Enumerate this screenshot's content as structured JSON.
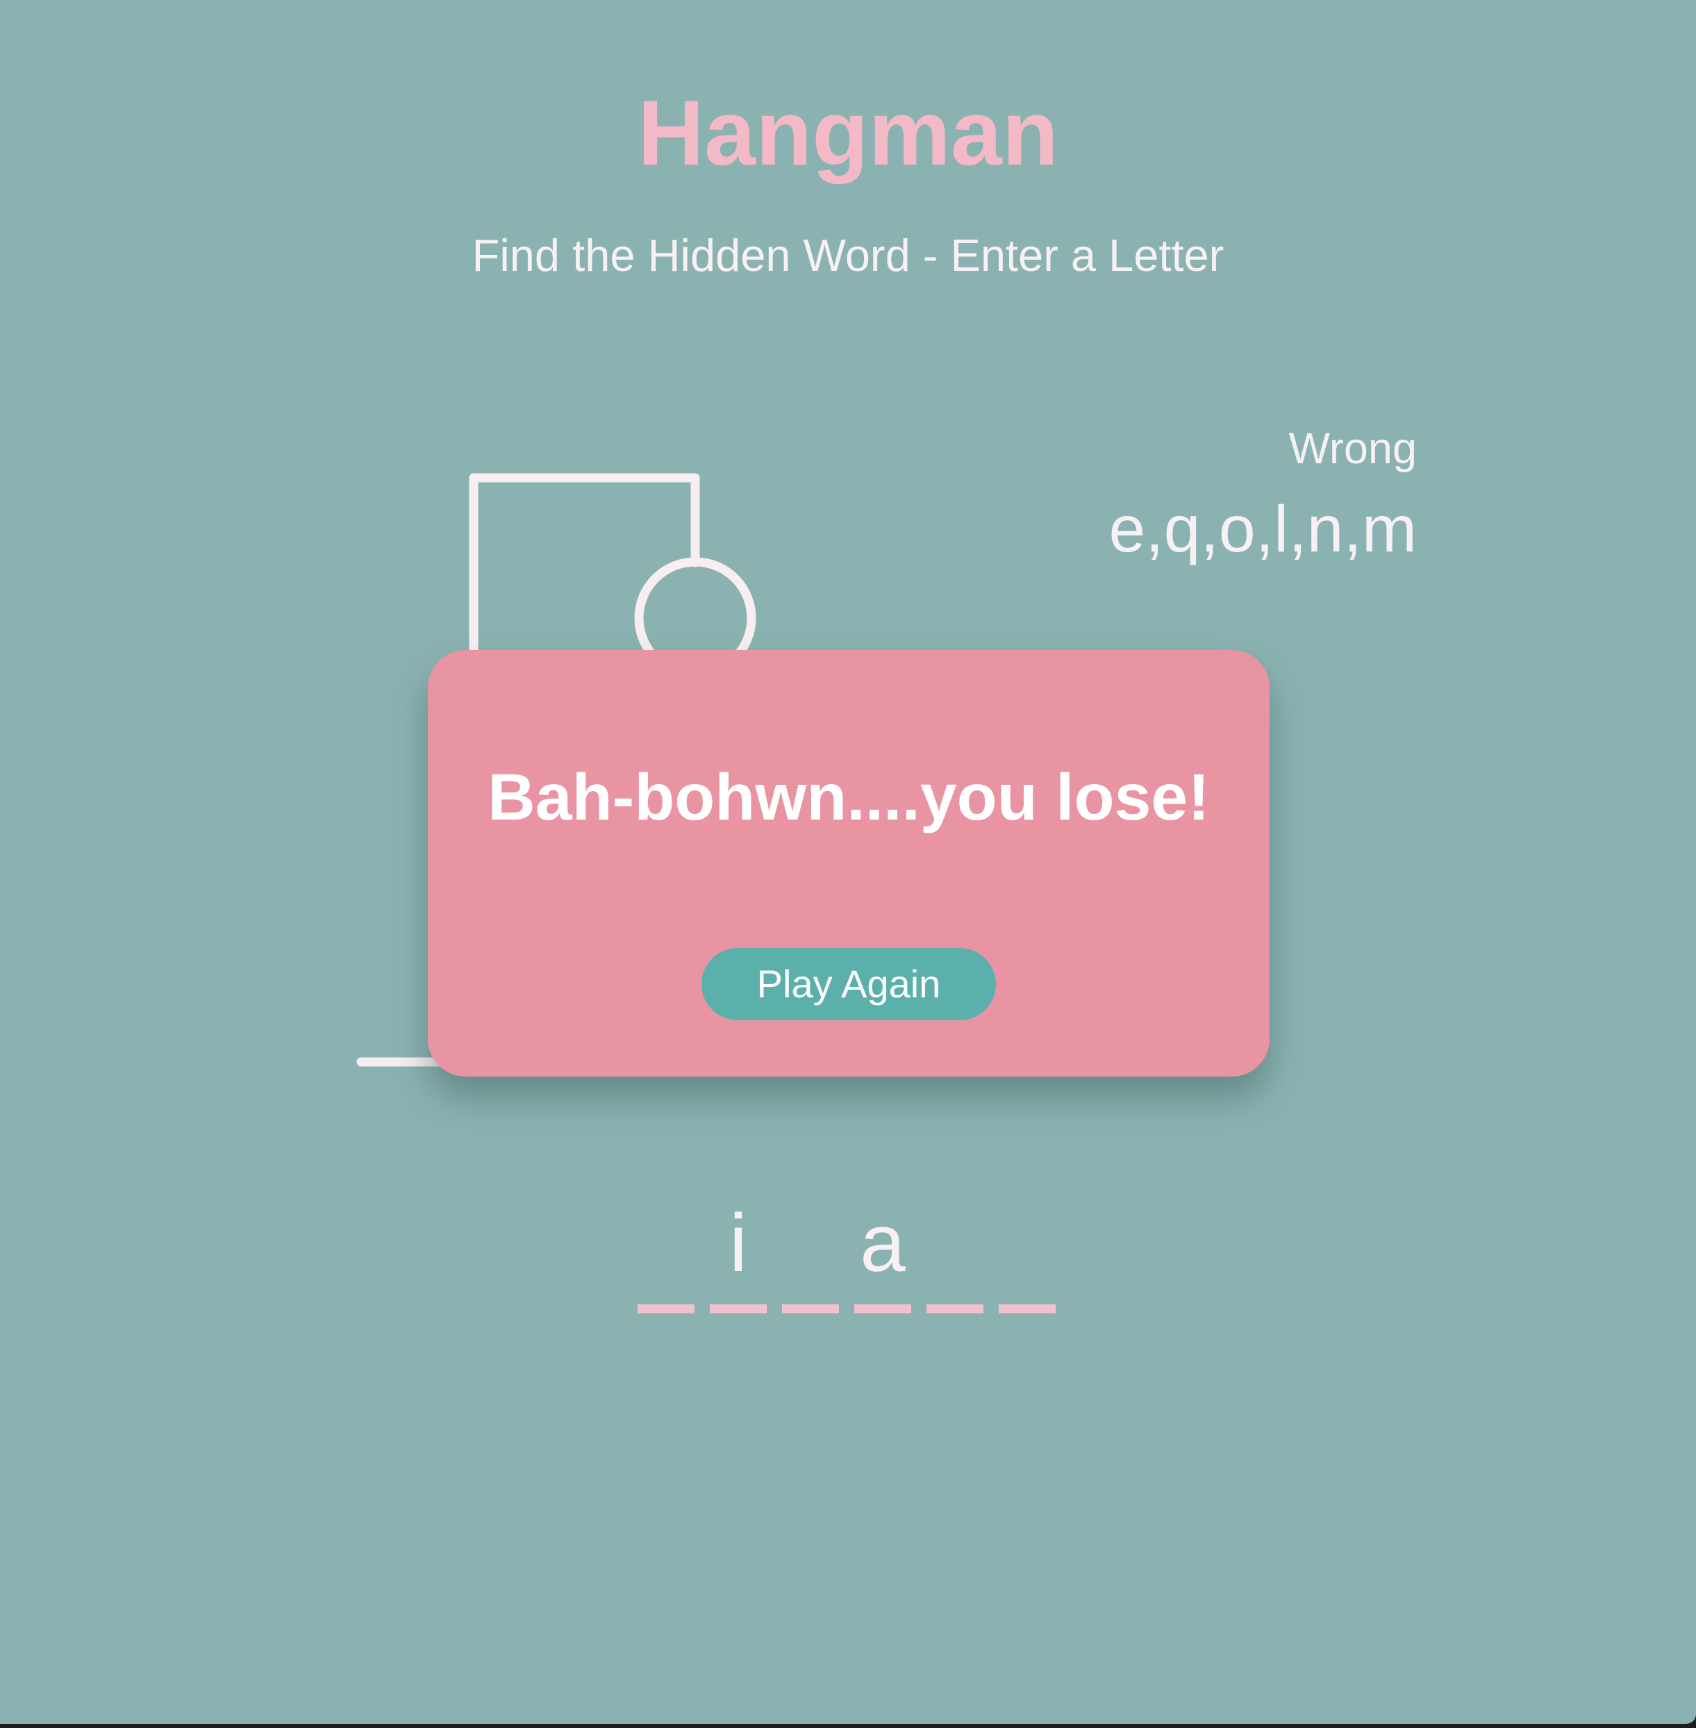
{
  "header": {
    "title": "Hangman",
    "subtitle": "Find the Hidden Word - Enter a Letter"
  },
  "wrong": {
    "label": "Wrong",
    "letters": "e,q,o,l,n,m"
  },
  "word": {
    "slots": [
      "",
      "i",
      "",
      "a",
      "",
      ""
    ]
  },
  "popup": {
    "message": "Bah-bohwn....you lose!",
    "button_label": "Play Again"
  },
  "colors": {
    "background": "#8ab2b1",
    "title": "#f4b9c6",
    "text": "#f8f1f3",
    "popup": "#e994a2",
    "button": "#5bb0ac",
    "underline": "#f1c2cd"
  }
}
